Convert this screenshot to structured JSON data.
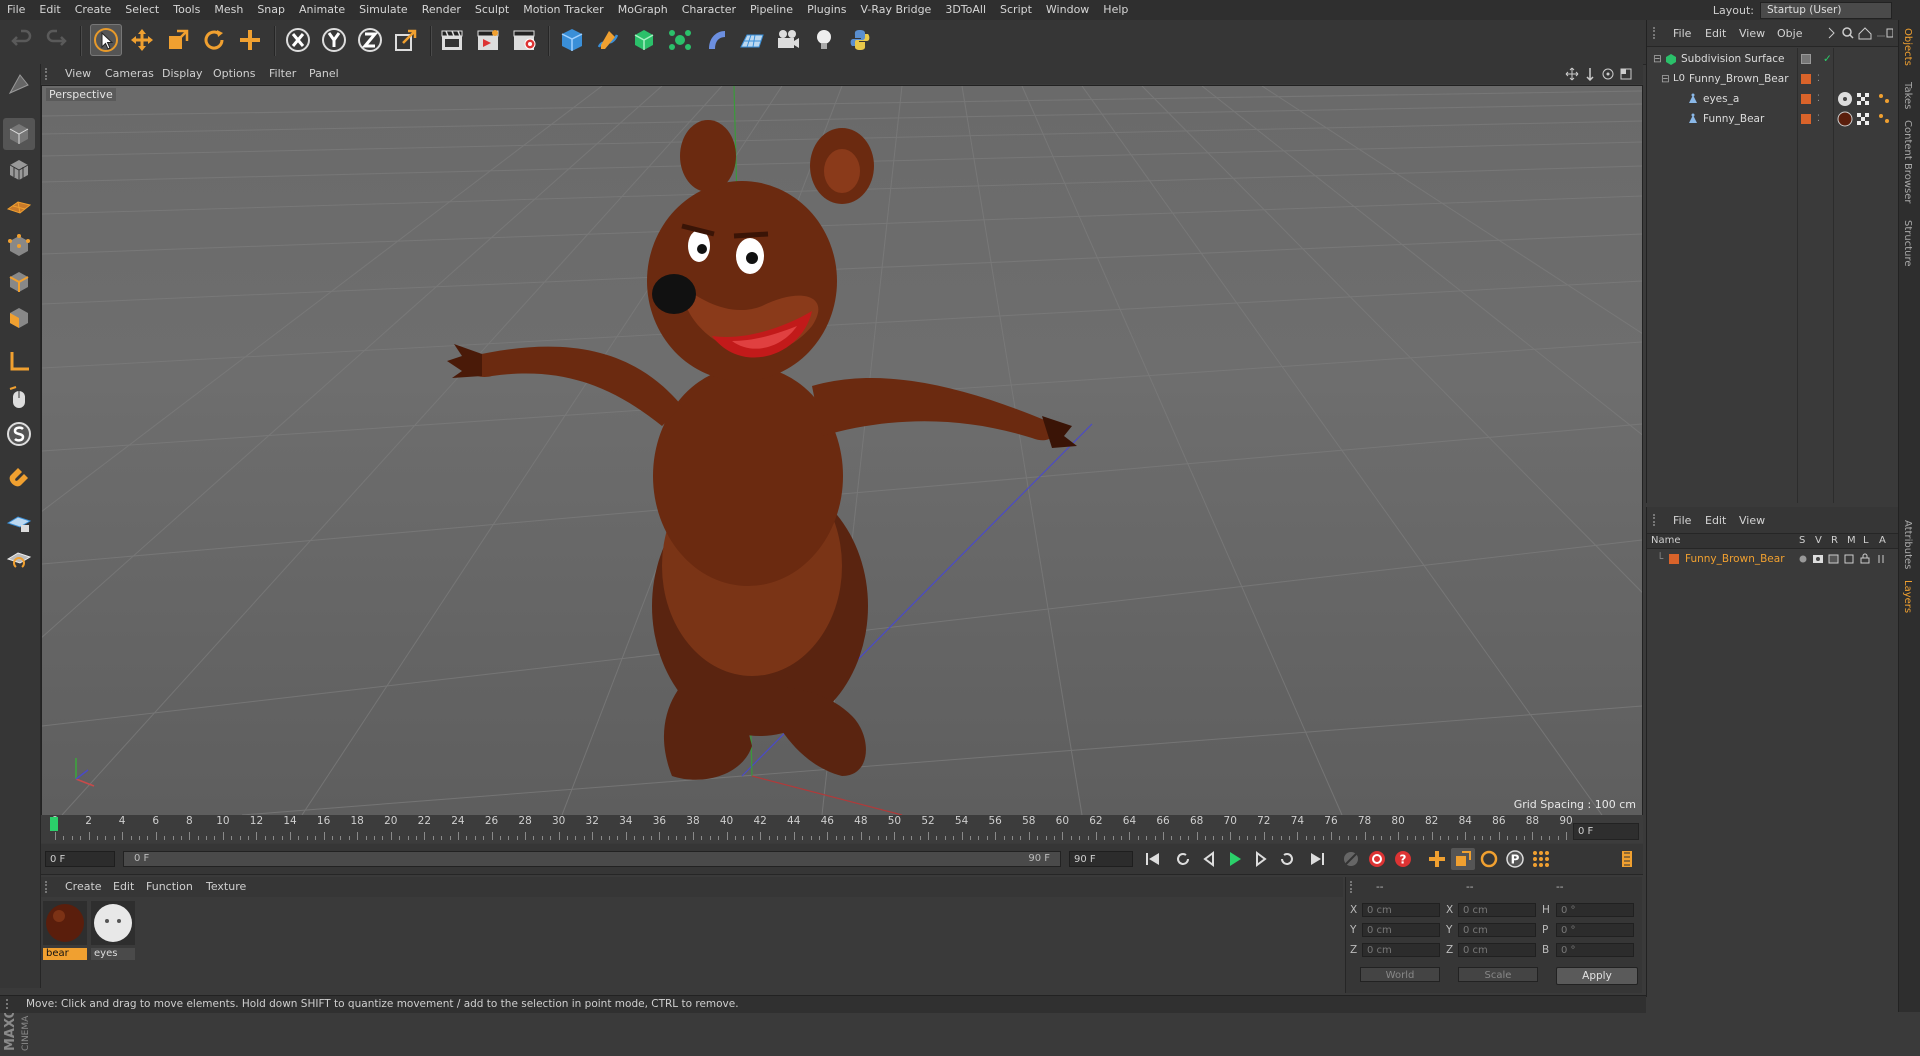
{
  "app": {
    "name": "Cinema 4D"
  },
  "menu": [
    "File",
    "Edit",
    "Create",
    "Select",
    "Tools",
    "Mesh",
    "Snap",
    "Animate",
    "Simulate",
    "Render",
    "Sculpt",
    "Motion Tracker",
    "MoGraph",
    "Character",
    "Pipeline",
    "Plugins",
    "V-Ray Bridge",
    "3DToAll",
    "Script",
    "Window",
    "Help"
  ],
  "layout": {
    "label": "Layout:",
    "value": "Startup (User)"
  },
  "viewport": {
    "menu": [
      "View",
      "Cameras",
      "Display",
      "Options",
      "Filter",
      "Panel"
    ],
    "label": "Perspective",
    "grid_spacing": "Grid Spacing : 100 cm"
  },
  "timeline": {
    "ticks": [
      "0",
      "2",
      "4",
      "6",
      "8",
      "10",
      "12",
      "14",
      "16",
      "18",
      "20",
      "22",
      "24",
      "26",
      "28",
      "30",
      "32",
      "34",
      "36",
      "38",
      "40",
      "42",
      "44",
      "46",
      "48",
      "50",
      "52",
      "54",
      "56",
      "58",
      "60",
      "62",
      "64",
      "66",
      "68",
      "70",
      "72",
      "74",
      "76",
      "78",
      "80",
      "82",
      "84",
      "86",
      "88",
      "90"
    ],
    "current_frame": "0 F"
  },
  "transport": {
    "start_field": "0 F",
    "range_start": "0 F",
    "range_end": "90 F",
    "end_field": "90 F"
  },
  "materials": {
    "menu": [
      "Create",
      "Edit",
      "Function",
      "Texture"
    ],
    "items": [
      {
        "name": "bear",
        "selected": true
      },
      {
        "name": "eyes",
        "selected": false
      }
    ]
  },
  "coordinates": {
    "header": [
      "--",
      "--",
      "--"
    ],
    "rows": [
      {
        "a_label": "X",
        "a_val": "0 cm",
        "b_label": "X",
        "b_val": "0 cm",
        "c_label": "H",
        "c_val": "0 °"
      },
      {
        "a_label": "Y",
        "a_val": "0 cm",
        "b_label": "Y",
        "b_val": "0 cm",
        "c_label": "P",
        "c_val": "0 °"
      },
      {
        "a_label": "Z",
        "a_val": "0 cm",
        "b_label": "Z",
        "b_val": "0 cm",
        "c_label": "B",
        "c_val": "0 °"
      }
    ],
    "mode": "World",
    "scale": "Scale",
    "apply": "Apply"
  },
  "status": "Move: Click and drag to move elements. Hold down SHIFT to quantize movement / add to the selection in point mode, CTRL to remove.",
  "object_manager": {
    "menu": [
      "File",
      "Edit",
      "View",
      "Obje"
    ],
    "objects": [
      {
        "name": "Subdivision Surface",
        "depth": 0
      },
      {
        "name": "Funny_Brown_Bear",
        "depth": 1
      },
      {
        "name": "eyes_a",
        "depth": 2
      },
      {
        "name": "Funny_Bear",
        "depth": 2
      }
    ]
  },
  "layer_manager": {
    "menu": [
      "File",
      "Edit",
      "View"
    ],
    "columns": [
      "Name",
      "S",
      "V",
      "R",
      "M",
      "L",
      "A"
    ],
    "layers": [
      {
        "name": "Funny_Brown_Bear"
      }
    ]
  },
  "right_tabs": [
    "Objects",
    "Takes",
    "Content Browser",
    "Structure",
    "Attributes",
    "Layers"
  ],
  "colors": {
    "accent_orange": "#f0a030",
    "layer_orange": "#d9632a",
    "bear_brown": "#6b2a10"
  },
  "logo": {
    "brand": "MAXON",
    "product": "CINEMA 4D"
  }
}
